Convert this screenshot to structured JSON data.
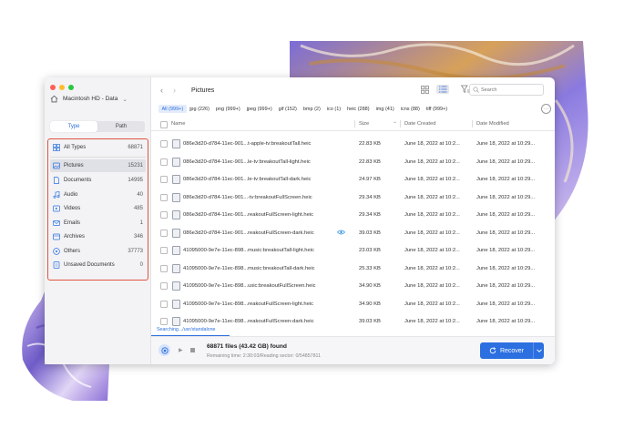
{
  "window": {
    "traffic_colors": [
      "#ff5f57",
      "#febc2e",
      "#28c840"
    ]
  },
  "sidebar": {
    "disk_name": "Macintosh HD - Data",
    "disk_chevron": "⌄",
    "tabs": [
      {
        "label": "Type",
        "active": true
      },
      {
        "label": "Path",
        "active": false
      }
    ],
    "types": [
      {
        "label": "All Types",
        "count": "68871",
        "icon": "all-types-icon",
        "selected": false
      },
      {
        "label": "Pictures",
        "count": "15231",
        "icon": "pictures-icon",
        "selected": true
      },
      {
        "label": "Documents",
        "count": "14995",
        "icon": "documents-icon",
        "selected": false
      },
      {
        "label": "Audio",
        "count": "40",
        "icon": "audio-icon",
        "selected": false
      },
      {
        "label": "Videos",
        "count": "485",
        "icon": "videos-icon",
        "selected": false
      },
      {
        "label": "Emails",
        "count": "1",
        "icon": "emails-icon",
        "selected": false
      },
      {
        "label": "Archives",
        "count": "346",
        "icon": "archives-icon",
        "selected": false
      },
      {
        "label": "Others",
        "count": "37773",
        "icon": "others-icon",
        "selected": false
      },
      {
        "label": "Unsaved Documents",
        "count": "0",
        "icon": "unsaved-documents-icon",
        "selected": false
      }
    ]
  },
  "header": {
    "back": "‹",
    "forward": "›",
    "title": "Pictures",
    "search_placeholder": "Search"
  },
  "filters": [
    {
      "label": "All (999+)",
      "active": true
    },
    {
      "label": "jpg (226)",
      "active": false
    },
    {
      "label": "png (999+)",
      "active": false
    },
    {
      "label": "jpeg (999+)",
      "active": false
    },
    {
      "label": "gif (152)",
      "active": false
    },
    {
      "label": "bmp (2)",
      "active": false
    },
    {
      "label": "ico (1)",
      "active": false
    },
    {
      "label": "heic (288)",
      "active": false
    },
    {
      "label": "img (41)",
      "active": false
    },
    {
      "label": "icns (88)",
      "active": false
    },
    {
      "label": "tiff (999+)",
      "active": false
    }
  ],
  "filters_more": "···",
  "table": {
    "columns": {
      "name": "Name",
      "size": "Size",
      "sort_arrow": "⌃",
      "created": "Date Created",
      "modified": "Date Modified"
    },
    "rows": [
      {
        "name": "086e3d20-d784-11ec-901...t-apple-tv:breakoutTall.heic",
        "size": "22.83 KB",
        "created": "June 18, 2022 at 10:2...",
        "modified": "June 18, 2022 at 10:29..."
      },
      {
        "name": "086e3d20-d784-11ec-901...le-tv:breakoutTall-light.heic",
        "size": "22.83 KB",
        "created": "June 18, 2022 at 10:2...",
        "modified": "June 18, 2022 at 10:29..."
      },
      {
        "name": "086e3d20-d784-11ec-901...le-tv:breakoutTall-dark.heic",
        "size": "24.97 KB",
        "created": "June 18, 2022 at 10:2...",
        "modified": "June 18, 2022 at 10:29..."
      },
      {
        "name": "086e3d20-d784-11ec-901...-tv:breakoutFullScreen.heic",
        "size": "29.34 KB",
        "created": "June 18, 2022 at 10:2...",
        "modified": "June 18, 2022 at 10:29..."
      },
      {
        "name": "086e3d20-d784-11ec-901...reakoutFullScreen-light.heic",
        "size": "29.34 KB",
        "created": "June 18, 2022 at 10:2...",
        "modified": "June 18, 2022 at 10:29..."
      },
      {
        "name": "086e3d20-d784-11ec-901...reakoutFullScreen-dark.heic",
        "size": "39.03 KB",
        "created": "June 18, 2022 at 10:2...",
        "modified": "June 18, 2022 at 10:29...",
        "preview": true
      },
      {
        "name": "41095000-9e7e-11ec-898...music:breakoutTall-light.heic",
        "size": "23.03 KB",
        "created": "June 18, 2022 at 10:2...",
        "modified": "June 18, 2022 at 10:29..."
      },
      {
        "name": "41095000-9e7e-11ec-898...music:breakoutTall-dark.heic",
        "size": "25.33 KB",
        "created": "June 18, 2022 at 10:2...",
        "modified": "June 18, 2022 at 10:29..."
      },
      {
        "name": "41095000-9e7e-11ec-898...usic:breakoutFullScreen.heic",
        "size": "34.90 KB",
        "created": "June 18, 2022 at 10:2...",
        "modified": "June 18, 2022 at 10:29..."
      },
      {
        "name": "41095000-9e7e-11ec-898...reakoutFullScreen-light.heic",
        "size": "34.90 KB",
        "created": "June 18, 2022 at 10:2...",
        "modified": "June 18, 2022 at 10:29..."
      },
      {
        "name": "41095000-9e7e-11ec-898...reakoutFullScreen-dark.heic",
        "size": "39.03 KB",
        "created": "June 18, 2022 at 10:2...",
        "modified": "June 18, 2022 at 10:29..."
      }
    ]
  },
  "status": {
    "searching": "Searching.../usr/standalone"
  },
  "footer": {
    "found": "68871 files (43.42 GB) found",
    "remaining": "Remaining time: 2:30:03/Reading sector: 0/54857811",
    "recover_label": "Recover"
  },
  "colors": {
    "accent": "#2b6fe0",
    "highlight_border": "#e0533f"
  }
}
